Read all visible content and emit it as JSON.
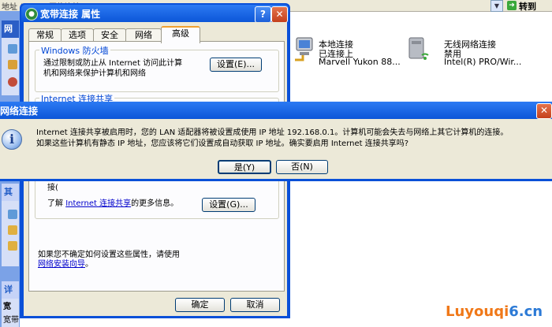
{
  "explorer": {
    "address_label": "地址 (D)",
    "address_value": "网络连接",
    "go_label": "转到",
    "left_panel": {
      "section1_head": "网",
      "section2_head": "其",
      "section3_head": "详",
      "section3_items": [
        "宽",
        "宽带"
      ]
    },
    "connections": [
      {
        "name": "本地连接",
        "status": "已连接上",
        "device": "Marvell Yukon 88..."
      },
      {
        "name": "无线网络连接",
        "status": "禁用",
        "device": "Intel(R) PRO/Wir..."
      }
    ]
  },
  "properties": {
    "title": "宽带连接 属性",
    "help_label": "?",
    "close_label": "✕",
    "tabs": [
      "常规",
      "选项",
      "安全",
      "网络",
      "高级"
    ],
    "active_tab": "高级",
    "firewall_group": "Windows 防火墙",
    "firewall_text_1": "通过限制或防止从 Internet 访问此计算",
    "firewall_text_2": "机和网络来保护计算机和网络",
    "firewall_settings": "设置(E)...",
    "ics_group": "Internet 连接共享",
    "ics_partial": "接(",
    "learn_prefix": "了解 ",
    "learn_link": "Internet 连接共享",
    "learn_suffix": "的更多信息。",
    "ics_settings": "设置(G)...",
    "help_text": "如果您不确定如何设置这些属性，请使用",
    "wizard_link": "网络安装向导",
    "wizard_suffix": "。",
    "ok": "确定",
    "cancel": "取消"
  },
  "message_box": {
    "title": "网络连接",
    "close_label": "✕",
    "icon": "info-icon",
    "line1": "Internet 连接共享被启用时，您的 LAN 适配器将被设置成使用 IP 地址 192.168.0.1。计算机可能会失去与网络上其它计算机的连接。",
    "line2": "如果这些计算机有静态 IP 地址，您应该将它们设置成自动获取 IP 地址。确实要启用 Internet 连接共享吗?",
    "yes": "是(Y)",
    "no": "否(N)"
  },
  "watermark": {
    "part1": "Luyouqi",
    "part2": "6.cn"
  },
  "colors": {
    "titlebar": "#0a50d8",
    "dialog_bg": "#ece9d8",
    "link": "#0000cc",
    "group_label": "#0046d5"
  }
}
